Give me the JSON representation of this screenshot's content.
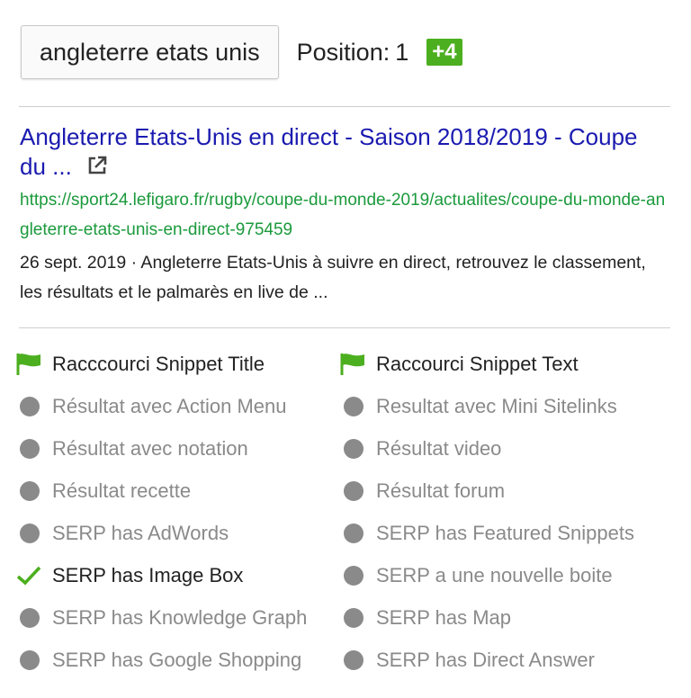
{
  "header": {
    "keyword": "angleterre etats unis",
    "position_label": "Position:",
    "position_value": "1",
    "delta": "+4"
  },
  "result": {
    "title": "Angleterre Etats-Unis en direct - Saison 2018/2019 - Coupe du ...",
    "url": "https://sport24.lefigaro.fr/rugby/coupe-du-monde-2019/actualites/coupe-du-monde-angleterre-etats-unis-en-direct-975459",
    "description": "26 sept. 2019 · Angleterre Etats-Unis à suivre en direct, retrouvez le classement, les résultats et le palmarès en live de ..."
  },
  "colors": {
    "link": "#1a1ab0",
    "url": "#1b9a3c",
    "accent_green": "#4caf1f",
    "inactive_gray": "#8a8a8a"
  },
  "features": [
    [
      {
        "label": "Racccourci Snippet Title",
        "status": "flag"
      },
      {
        "label": "Raccourci Snippet Text",
        "status": "flag"
      }
    ],
    [
      {
        "label": "Résultat avec Action Menu",
        "status": "inactive"
      },
      {
        "label": "Resultat avec Mini Sitelinks",
        "status": "inactive"
      }
    ],
    [
      {
        "label": "Résultat avec notation",
        "status": "inactive"
      },
      {
        "label": "Résultat video",
        "status": "inactive"
      }
    ],
    [
      {
        "label": "Résultat recette",
        "status": "inactive"
      },
      {
        "label": "Résultat forum",
        "status": "inactive"
      }
    ],
    [
      {
        "label": "SERP has AdWords",
        "status": "inactive"
      },
      {
        "label": "SERP has Featured Snippets",
        "status": "inactive"
      }
    ],
    [
      {
        "label": "SERP has Image Box",
        "status": "check"
      },
      {
        "label": "SERP a une nouvelle boite",
        "status": "inactive"
      }
    ],
    [
      {
        "label": "SERP has Knowledge Graph",
        "status": "inactive"
      },
      {
        "label": "SERP has Map",
        "status": "inactive"
      }
    ],
    [
      {
        "label": "SERP has Google Shopping",
        "status": "inactive"
      },
      {
        "label": "SERP has Direct Answer",
        "status": "inactive"
      }
    ]
  ]
}
